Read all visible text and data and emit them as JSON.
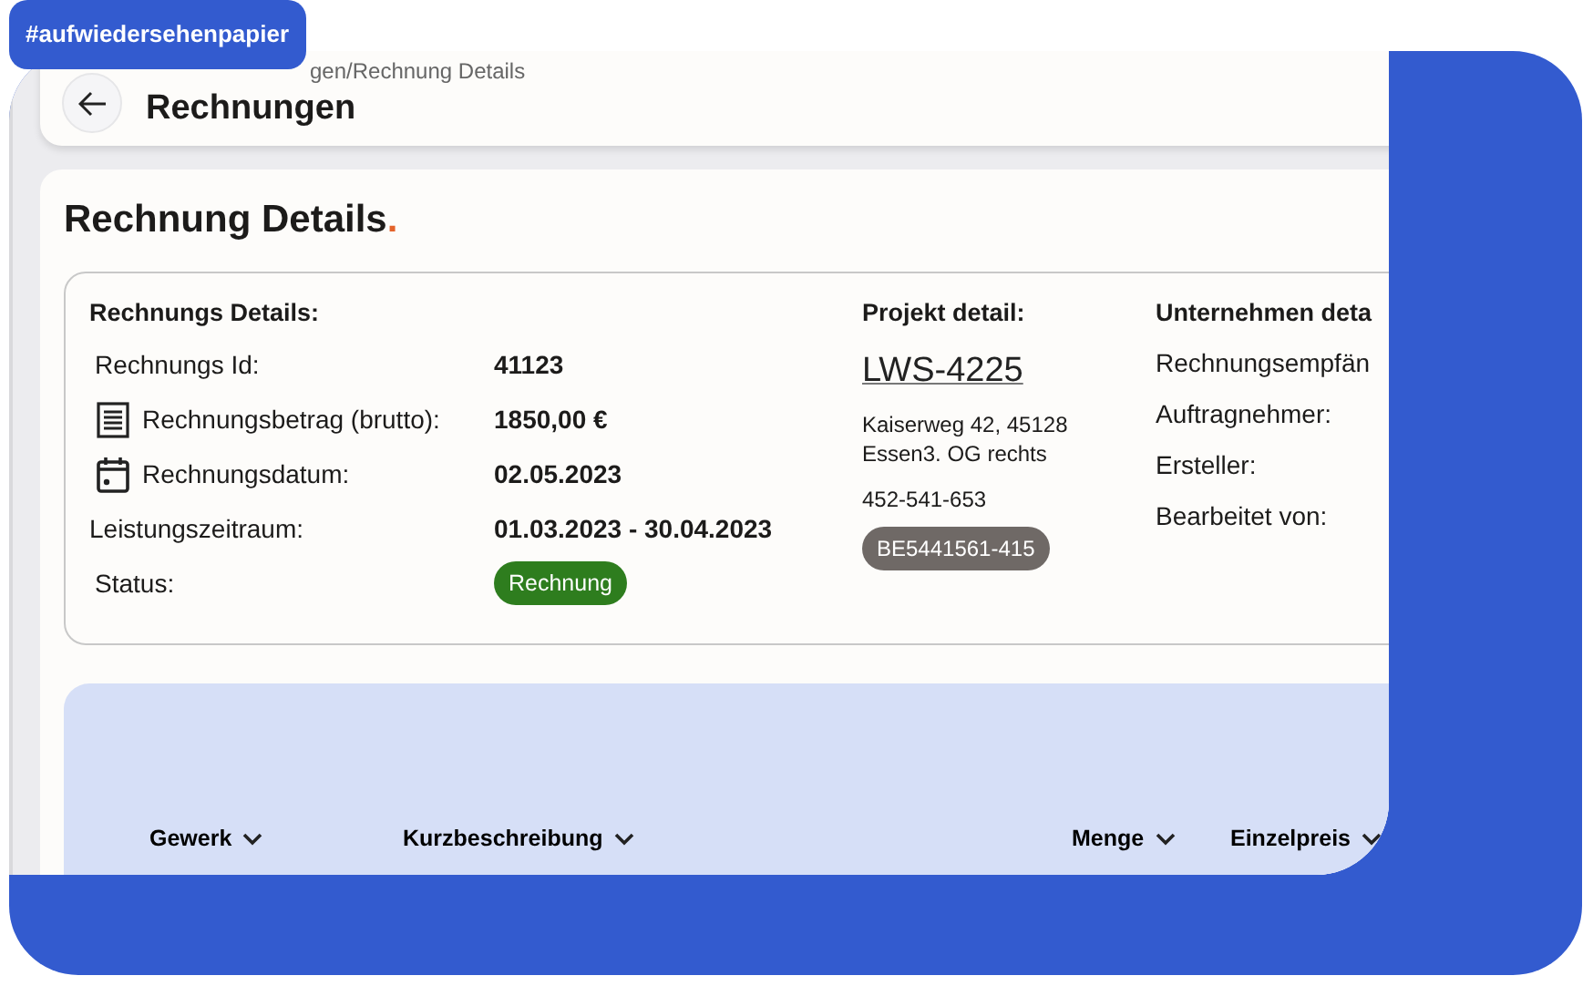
{
  "tag": "#aufwiedersehenpapier",
  "header": {
    "breadcrumb": "gen/Rechnung Details",
    "title": "Rechnungen"
  },
  "details": {
    "title": "Rechnung Details",
    "title_mark": ".",
    "invoice": {
      "heading": "Rechnungs Details:",
      "rows": [
        {
          "kind": "plain",
          "label": "Rechnungs Id:",
          "value": "41123"
        },
        {
          "kind": "receipt",
          "label": "Rechnungsbetrag (brutto):",
          "value": "1850,00 €"
        },
        {
          "kind": "calendar",
          "label": "Rechnungsdatum:",
          "value": "02.05.2023"
        },
        {
          "kind": "flush",
          "label": "Leistungszeitraum:",
          "value": "01.03.2023 - 30.04.2023"
        },
        {
          "kind": "status",
          "label": "Status:",
          "value": "Rechnung"
        }
      ]
    },
    "project": {
      "heading": "Projekt detail:",
      "code": "LWS-4225",
      "address": [
        "Kaiserweg 42, 45128",
        "Essen3. OG rechts"
      ],
      "phone": "452-541-653",
      "badge": "BE5441561-415"
    },
    "company": {
      "heading": "Unternehmen deta",
      "labels": [
        "Rechnungsempfän",
        "Auftragnehmer:",
        "Ersteller:",
        "Bearbeitet von:"
      ]
    }
  },
  "table": {
    "columns": [
      "Gewerk",
      "Kurzbeschreibung",
      "Menge",
      "Einzelpreis"
    ]
  }
}
